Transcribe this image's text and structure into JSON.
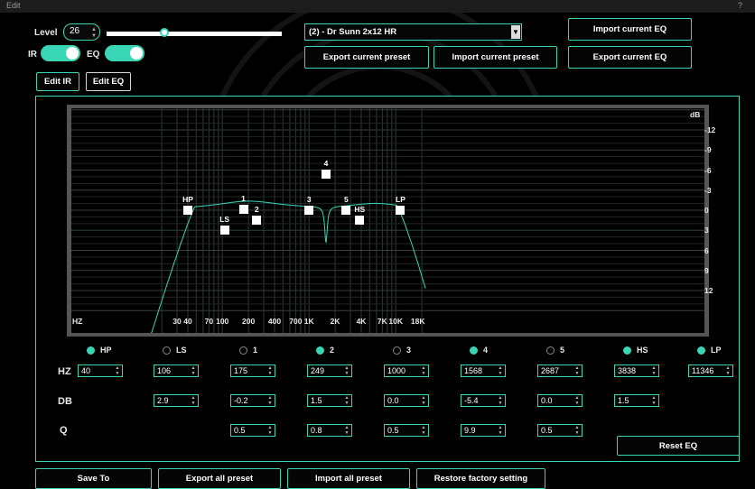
{
  "window": {
    "title": "Edit",
    "help": "?"
  },
  "controls": {
    "level_label": "Level",
    "level_value": "26",
    "ir_label": "IR",
    "eq_label": "EQ",
    "level_slider_fraction": 0.34
  },
  "preset": {
    "selected": "(2) - Dr Sunn 2x12 HR",
    "export_current_preset": "Export current preset",
    "import_current_preset": "Import current preset"
  },
  "eq_actions": {
    "import_current_eq": "Import current EQ",
    "export_current_eq": "Export current EQ"
  },
  "tabs": {
    "edit_ir": "Edit IR",
    "edit_eq": "Edit EQ"
  },
  "graph": {
    "x_unit": "HZ",
    "y_unit": "dB",
    "x_ticks": [
      "30",
      "40",
      "70",
      "100",
      "200",
      "400",
      "700",
      "1K",
      "2K",
      "4K",
      "7K",
      "10K",
      "18K"
    ],
    "y_ticks": [
      "-12",
      "-9",
      "-6",
      "-3",
      "0",
      "3",
      "6",
      "9",
      "12"
    ],
    "points": [
      {
        "label": "HP",
        "hz": 40,
        "db": 0
      },
      {
        "label": "LS",
        "hz": 106,
        "db": 2.9
      },
      {
        "label": "1",
        "hz": 175,
        "db": -0.2
      },
      {
        "label": "2",
        "hz": 249,
        "db": 1.5
      },
      {
        "label": "3",
        "hz": 1000,
        "db": 0.0
      },
      {
        "label": "4",
        "hz": 1568,
        "db": -5.4
      },
      {
        "label": "5",
        "hz": 2687,
        "db": 0.0
      },
      {
        "label": "HS",
        "hz": 3838,
        "db": 1.5
      },
      {
        "label": "LP",
        "hz": 11346,
        "db": 0
      }
    ],
    "curve_color": "#39d6b6"
  },
  "bands": [
    {
      "name": "HP",
      "on": true,
      "hz": "40"
    },
    {
      "name": "LS",
      "on": false,
      "hz": "106",
      "db": "2.9"
    },
    {
      "name": "1",
      "on": false,
      "hz": "175",
      "db": "-0.2",
      "q": "0.5"
    },
    {
      "name": "2",
      "on": true,
      "hz": "249",
      "db": "1.5",
      "q": "0.8"
    },
    {
      "name": "3",
      "on": false,
      "hz": "1000",
      "db": "0.0",
      "q": "0.5"
    },
    {
      "name": "4",
      "on": true,
      "hz": "1568",
      "db": "-5.4",
      "q": "9.9"
    },
    {
      "name": "5",
      "on": false,
      "hz": "2687",
      "db": "0.0",
      "q": "0.5"
    },
    {
      "name": "HS",
      "on": true,
      "hz": "3838",
      "db": "1.5"
    },
    {
      "name": "LP",
      "on": true,
      "hz": "11346"
    }
  ],
  "row_labels": {
    "hz": "HZ",
    "db": "DB",
    "q": "Q"
  },
  "reset_eq": "Reset EQ",
  "footer": {
    "save_to": "Save To",
    "export_all": "Export all preset",
    "import_all": "Import all preset",
    "restore": "Restore factory setting"
  },
  "colors": {
    "accent": "#39d6b6",
    "background": "#000000"
  }
}
